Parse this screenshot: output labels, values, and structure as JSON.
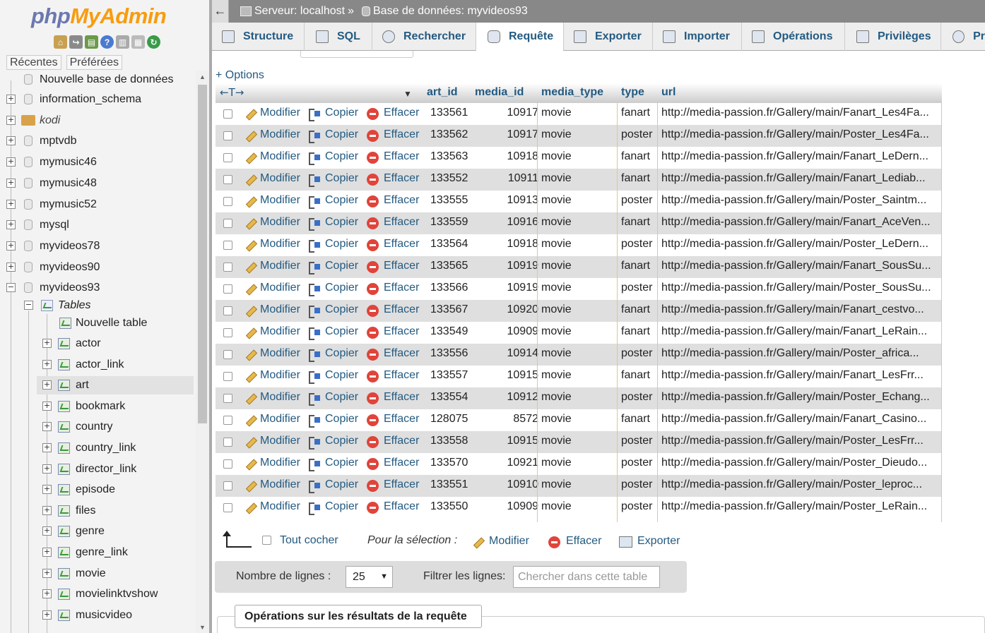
{
  "sidebar": {
    "logo_php": "php",
    "logo_myadmin": "MyAdmin",
    "tab_recent": "Récentes",
    "tab_favorites": "Préférées",
    "new_database": "Nouvelle base de données",
    "databases": [
      "information_schema",
      "kodi",
      "mptvdb",
      "mymusic46",
      "mymusic48",
      "mymusic52",
      "mysql",
      "myvideos78",
      "myvideos90",
      "myvideos93"
    ],
    "tables_label": "Tables",
    "new_table": "Nouvelle table",
    "tables": [
      "actor",
      "actor_link",
      "art",
      "bookmark",
      "country",
      "country_link",
      "director_link",
      "episode",
      "files",
      "genre",
      "genre_link",
      "movie",
      "movielinktvshow",
      "musicvideo"
    ],
    "selected_table": "art"
  },
  "topbar": {
    "server": "Serveur: localhost",
    "sep": "»",
    "database": "Base de données: myvideos93",
    "collapse": "←"
  },
  "tabs": [
    "Structure",
    "SQL",
    "Rechercher",
    "Requête",
    "Exporter",
    "Importer",
    "Opérations",
    "Privilèges",
    "Pr"
  ],
  "active_tab": "Requête",
  "options_link": "+ Options",
  "table": {
    "headers": [
      "art_id",
      "media_id",
      "media_type",
      "type",
      "url"
    ],
    "action_edit": "Modifier",
    "action_copy": "Copier",
    "action_delete": "Effacer",
    "rows": [
      [
        "133561",
        "10917",
        "movie",
        "fanart",
        "http://media-passion.fr/Gallery/main/Fanart_Les4Fa..."
      ],
      [
        "133562",
        "10917",
        "movie",
        "poster",
        "http://media-passion.fr/Gallery/main/Poster_Les4Fa..."
      ],
      [
        "133563",
        "10918",
        "movie",
        "fanart",
        "http://media-passion.fr/Gallery/main/Fanart_LeDern..."
      ],
      [
        "133552",
        "10911",
        "movie",
        "fanart",
        "http://media-passion.fr/Gallery/main/Fanart_Lediab..."
      ],
      [
        "133555",
        "10913",
        "movie",
        "poster",
        "http://media-passion.fr/Gallery/main/Poster_Saintm..."
      ],
      [
        "133559",
        "10916",
        "movie",
        "fanart",
        "http://media-passion.fr/Gallery/main/Fanart_AceVen..."
      ],
      [
        "133564",
        "10918",
        "movie",
        "poster",
        "http://media-passion.fr/Gallery/main/Poster_LeDern..."
      ],
      [
        "133565",
        "10919",
        "movie",
        "fanart",
        "http://media-passion.fr/Gallery/main/Fanart_SousSu..."
      ],
      [
        "133566",
        "10919",
        "movie",
        "poster",
        "http://media-passion.fr/Gallery/main/Poster_SousSu..."
      ],
      [
        "133567",
        "10920",
        "movie",
        "fanart",
        "http://media-passion.fr/Gallery/main/Fanart_cestvo..."
      ],
      [
        "133549",
        "10909",
        "movie",
        "fanart",
        "http://media-passion.fr/Gallery/main/Fanart_LeRain..."
      ],
      [
        "133556",
        "10914",
        "movie",
        "poster",
        "http://media-passion.fr/Gallery/main/Poster_africa..."
      ],
      [
        "133557",
        "10915",
        "movie",
        "fanart",
        "http://media-passion.fr/Gallery/main/Fanart_LesFrr..."
      ],
      [
        "133554",
        "10912",
        "movie",
        "poster",
        "http://media-passion.fr/Gallery/main/Poster_Echang..."
      ],
      [
        "128075",
        "8572",
        "movie",
        "fanart",
        "http://media-passion.fr/Gallery/main/Fanart_Casino..."
      ],
      [
        "133558",
        "10915",
        "movie",
        "poster",
        "http://media-passion.fr/Gallery/main/Poster_LesFrr..."
      ],
      [
        "133570",
        "10921",
        "movie",
        "poster",
        "http://media-passion.fr/Gallery/main/Poster_Dieudo..."
      ],
      [
        "133551",
        "10910",
        "movie",
        "poster",
        "http://media-passion.fr/Gallery/main/Poster_leproc..."
      ],
      [
        "133550",
        "10909",
        "movie",
        "poster",
        "http://media-passion.fr/Gallery/main/Poster_LeRain..."
      ]
    ]
  },
  "bulk": {
    "check_all": "Tout cocher",
    "for_selection": "Pour la sélection :",
    "edit": "Modifier",
    "delete": "Effacer",
    "export": "Exporter"
  },
  "nav": {
    "rows_label": "Nombre de lignes :",
    "rows_value": "25",
    "filter_label": "Filtrer les lignes:",
    "filter_placeholder": "Chercher dans cette table"
  },
  "query_ops": "Opérations sur les résultats de la requête",
  "colors": {
    "link": "#235a81",
    "row_alt": "#dfdfdf",
    "topbar": "#888888",
    "accent": "#f89c0e"
  }
}
